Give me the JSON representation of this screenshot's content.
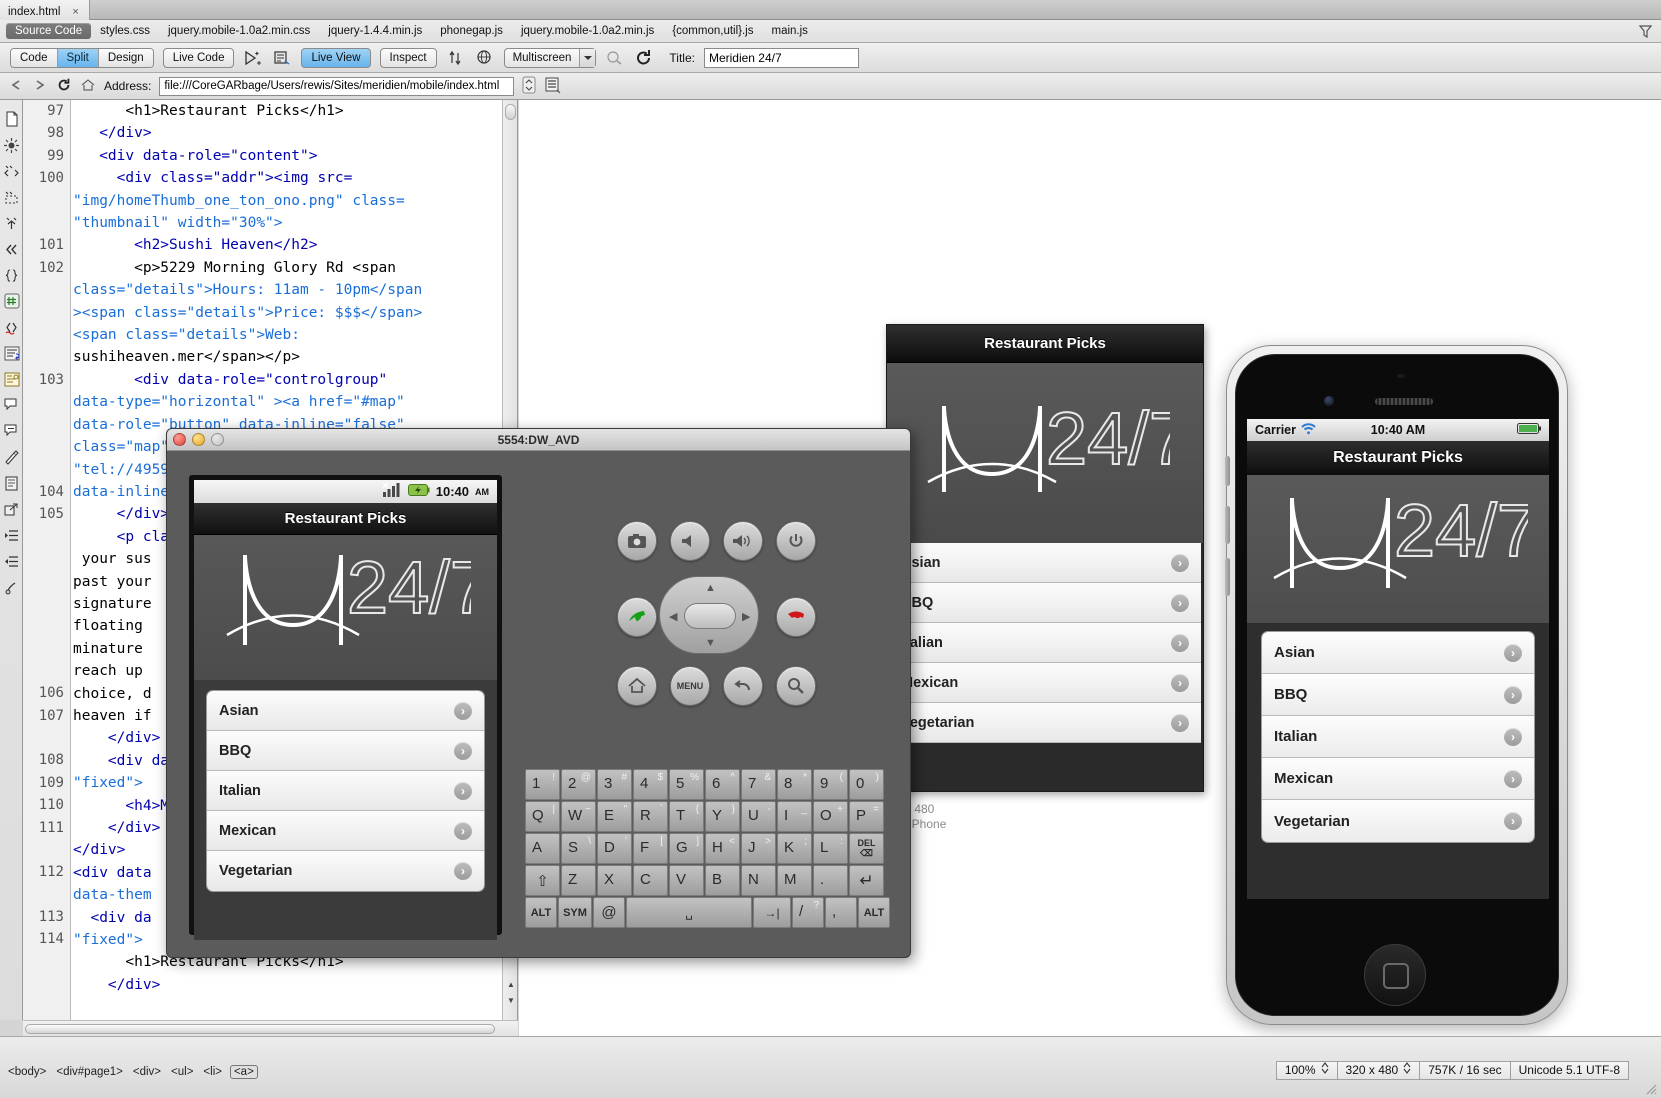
{
  "window": {
    "document_tab": "index.html",
    "close_label": "×"
  },
  "related_files": {
    "items": [
      {
        "label": "Source Code",
        "active": true
      },
      {
        "label": "styles.css",
        "active": false
      },
      {
        "label": "jquery.mobile-1.0a2.min.css",
        "active": false
      },
      {
        "label": "jquery-1.4.4.min.js",
        "active": false
      },
      {
        "label": "phonegap.js",
        "active": false
      },
      {
        "label": "jquery.mobile-1.0a2.min.js",
        "active": false
      },
      {
        "label": "{common,util}.js",
        "active": false
      },
      {
        "label": "main.js",
        "active": false
      }
    ],
    "filter_icon": "filter-icon"
  },
  "toolbar": {
    "view_modes": [
      {
        "label": "Code",
        "active": false
      },
      {
        "label": "Split",
        "active": true
      },
      {
        "label": "Design",
        "active": false
      }
    ],
    "live_code": "Live Code",
    "live_view": "Live View",
    "inspect": "Inspect",
    "multiscreen": "Multiscreen",
    "dropdown_arrow": "▼",
    "title_label": "Title:",
    "title_value": "Meridien 24/7",
    "icons": [
      "live-view-options-icon",
      "browser-check-icon",
      "validate-icon",
      "browser-preview-icon",
      "visual-aids-icon",
      "refresh-icon"
    ]
  },
  "address_bar": {
    "back_icon": "back-arrow-icon",
    "forward_icon": "forward-arrow-icon",
    "refresh_icon": "refresh-icon",
    "home_icon": "home-icon",
    "label": "Address:",
    "value": "file:///CoreGARbage/Users/rewis/Sites/meridien/mobile/index.html",
    "stepper_icon": "stepper-icon",
    "file-management_icon": "file-management-icon"
  },
  "code_rail": {
    "icons": [
      "open-documents-icon",
      "show-code-navigator-icon",
      "collapse-full-tag-icon",
      "collapse-selection-icon",
      "expand-all-icon",
      "select-parent-tag-icon",
      "balance-braces-icon",
      "line-numbers-icon",
      "highlight-invalid-code-icon",
      "word-wrap-icon",
      "syntax-color-icon",
      "apply-comment-icon",
      "remove-comment-icon",
      "wrap-tag-icon",
      "recent-snippets-icon",
      "move-to-external-icon",
      "indent-code-icon",
      "outdent-code-icon",
      "format-source-icon"
    ]
  },
  "code": {
    "lines": [
      {
        "num": "97",
        "segments": [
          {
            "t": "      ",
            "c": "tx"
          },
          {
            "t": "<h1>",
            "c": "tg"
          },
          {
            "t": "Restaurant Picks",
            "c": "tx"
          },
          {
            "t": "</h1>",
            "c": "tg"
          }
        ]
      },
      {
        "num": "98",
        "segments": [
          {
            "t": "   ",
            "c": "tx"
          },
          {
            "t": "</div>",
            "c": "tg"
          }
        ]
      },
      {
        "num": "99",
        "segments": [
          {
            "t": "   ",
            "c": "tx"
          },
          {
            "t": "<div ",
            "c": "tg"
          },
          {
            "t": "data-role=",
            "c": "at"
          },
          {
            "t": "\"content\"",
            "c": "vl"
          },
          {
            "t": ">",
            "c": "tg"
          }
        ]
      },
      {
        "num": "100",
        "segments": [
          {
            "t": "     ",
            "c": "tx"
          },
          {
            "t": "<div ",
            "c": "tg"
          },
          {
            "t": "class=",
            "c": "at"
          },
          {
            "t": "\"addr\"",
            "c": "vl"
          },
          {
            "t": ">",
            "c": "tg"
          },
          {
            "t": "<img ",
            "c": "tg"
          },
          {
            "t": "src=",
            "c": "at"
          },
          {
            "t": "\"img/homeThumb_one_ton_ono.png\" ",
            "c": "vl"
          },
          {
            "t": "class=",
            "c": "at"
          },
          {
            "t": "\"thumbnail\" ",
            "c": "vl"
          },
          {
            "t": "width=",
            "c": "at"
          },
          {
            "t": "\"30%\"",
            "c": "vl"
          },
          {
            "t": ">",
            "c": "tg"
          }
        ]
      },
      {
        "num": "101",
        "segments": [
          {
            "t": "       ",
            "c": "tx"
          },
          {
            "t": "<h2>",
            "c": "tg"
          },
          {
            "t": "Sushi Heaven",
            "c": "tx"
          },
          {
            "t": "</h2>",
            "c": "tg"
          }
        ]
      },
      {
        "num": "102",
        "segments": [
          {
            "t": "       ",
            "c": "tx"
          },
          {
            "t": "<p>",
            "c": "tg"
          },
          {
            "t": "5229 Morning Glory Rd ",
            "c": "tx"
          },
          {
            "t": "<span ",
            "c": "tg"
          },
          {
            "t": "class=",
            "c": "at"
          },
          {
            "t": "\"details\"",
            "c": "vl"
          },
          {
            "t": ">",
            "c": "tg"
          },
          {
            "t": "Hours: 11am - 10pm",
            "c": "tx"
          },
          {
            "t": "</span",
            "c": "tg"
          },
          {
            "t": "><span ",
            "c": "tg"
          },
          {
            "t": "class=",
            "c": "at"
          },
          {
            "t": "\"details\"",
            "c": "vl"
          },
          {
            "t": ">",
            "c": "tg"
          },
          {
            "t": "Price: $$$",
            "c": "tx"
          },
          {
            "t": "</span>",
            "c": "tg"
          },
          {
            "t": "<span ",
            "c": "tg"
          },
          {
            "t": "class=",
            "c": "at"
          },
          {
            "t": "\"details\"",
            "c": "vl"
          },
          {
            "t": ">",
            "c": "tg"
          },
          {
            "t": "Web: sushiheaven.mer",
            "c": "tx"
          },
          {
            "t": "</span></p>",
            "c": "tg"
          }
        ]
      },
      {
        "num": "103",
        "segments": [
          {
            "t": "       ",
            "c": "tx"
          },
          {
            "t": "<div ",
            "c": "tg"
          },
          {
            "t": "data-role=",
            "c": "at"
          },
          {
            "t": "\"controlgroup\" ",
            "c": "vl"
          },
          {
            "t": "data-type=",
            "c": "at"
          },
          {
            "t": "\"horizontal\" ",
            "c": "vl"
          },
          {
            "t": "><a ",
            "c": "gn"
          },
          {
            "t": "href=",
            "c": "at"
          },
          {
            "t": "\"#map\" ",
            "c": "vl"
          },
          {
            "t": "data-role=",
            "c": "at"
          },
          {
            "t": "\"button\" ",
            "c": "vl"
          },
          {
            "t": "data-inline=",
            "c": "at"
          },
          {
            "t": "\"false\" ",
            "c": "vl"
          },
          {
            "t": "class=",
            "c": "at"
          },
          {
            "t": "\"map\" ",
            "c": "vl"
          },
          {
            "t": "\"tel://49",
            "c": "vl"
          },
          {
            "t": "data-inli",
            "c": "at"
          }
        ]
      },
      {
        "num": "104",
        "segments": [
          {
            "t": "     ",
            "c": "tx"
          },
          {
            "t": "</div>",
            "c": "tg"
          }
        ]
      },
      {
        "num": "105",
        "segments": [
          {
            "t": "     ",
            "c": "tx"
          },
          {
            "t": "<p ",
            "c": "tg"
          },
          {
            "t": "cl",
            "c": "at"
          },
          {
            "t": "  your sus",
            "c": "tx"
          },
          {
            "t": "past your",
            "c": "tx"
          },
          {
            "t": "signature",
            "c": "tx"
          },
          {
            "t": "floating",
            "c": "tx"
          },
          {
            "t": "minature",
            "c": "tx"
          },
          {
            "t": "reach up",
            "c": "tx"
          },
          {
            "t": "choice, d",
            "c": "tx"
          },
          {
            "t": "heaven if",
            "c": "tx"
          }
        ]
      },
      {
        "num": "106",
        "segments": [
          {
            "t": "    ",
            "c": "tx"
          },
          {
            "t": "</div>",
            "c": "tg"
          }
        ]
      },
      {
        "num": "107",
        "segments": [
          {
            "t": "    ",
            "c": "tx"
          },
          {
            "t": "<div ",
            "c": "tg"
          },
          {
            "t": "da",
            "c": "at"
          },
          {
            "t": "\"fixed\"",
            "c": "vl"
          },
          {
            "t": ">",
            "c": "tg"
          }
        ]
      },
      {
        "num": "108",
        "segments": [
          {
            "t": "      ",
            "c": "tx"
          },
          {
            "t": "<h4>",
            "c": "tg"
          },
          {
            "t": "M",
            "c": "tx"
          }
        ]
      },
      {
        "num": "109",
        "segments": [
          {
            "t": "    ",
            "c": "tx"
          },
          {
            "t": "</div>",
            "c": "tg"
          }
        ]
      },
      {
        "num": "110",
        "segments": [
          {
            "t": "",
            "c": "tx"
          },
          {
            "t": "</div>",
            "c": "tg"
          }
        ]
      },
      {
        "num": "111",
        "segments": [
          {
            "t": "",
            "c": "tx"
          },
          {
            "t": "<div ",
            "c": "tg"
          },
          {
            "t": "data",
            "c": "at"
          },
          {
            "t": "data-them",
            "c": "at"
          }
        ]
      },
      {
        "num": "112",
        "segments": [
          {
            "t": "  ",
            "c": "tx"
          },
          {
            "t": "<div ",
            "c": "tg"
          },
          {
            "t": "da",
            "c": "at"
          },
          {
            "t": "\"fixed\"",
            "c": "vl"
          },
          {
            "t": ">",
            "c": "tg"
          }
        ]
      },
      {
        "num": "113",
        "segments": [
          {
            "t": "      ",
            "c": "tx"
          },
          {
            "t": "<h1>",
            "c": "tg"
          },
          {
            "t": "Restaurant Picks",
            "c": "tx"
          },
          {
            "t": "</h1>",
            "c": "tg"
          }
        ]
      },
      {
        "num": "114",
        "segments": [
          {
            "t": "    ",
            "c": "tx"
          },
          {
            "t": "</div>",
            "c": "tg"
          }
        ]
      }
    ]
  },
  "code_display": {
    "l97": "      <h1>Restaurant Picks</h1>",
    "l98": "   </div>",
    "l99": "   <div data-role=\"content\">",
    "l100a": "     <div class=\"addr\"><img src=",
    "l100b": "\"img/homeThumb_one_ton_ono.png\" class=",
    "l100c": "\"thumbnail\" width=\"30%\">",
    "l101": "       <h2>Sushi Heaven</h2>",
    "l102a": "       <p>5229 Morning Glory Rd <span",
    "l102b": "class=\"details\">Hours: 11am - 10pm</span",
    "l102c": "><span class=\"details\">Price: $$$</span>",
    "l102d": "<span class=\"details\">Web:",
    "l102e": "sushiheaven.mer</span></p>",
    "l103a": "       <div data-role=\"controlgroup\"",
    "l103b": "data-type=\"horizontal\" ><a href=\"#map\"",
    "l103c": "data-role=\"button\" data-inline=\"false\"",
    "l103d": "class=\"map\"><a href=",
    "l103e": "\"tel://4959872\" data-role=\"button\"",
    "l103f": "data-inline=\"false\">",
    "l104": "     </div>",
    "l105a": "     <p class=\"descr\">",
    "l105b": " your sus",
    "l105c": "past your",
    "l105d": "signature",
    "l105e": "floating",
    "l105f": "minature",
    "l105g": "reach up",
    "l105h": "choice, d",
    "l105i": "heaven if",
    "l106": "    </div>",
    "l107a": "    <div da",
    "l107b": "\"fixed\">",
    "l108": "      <h4>M",
    "l109": "    </div>",
    "l110": "</div>",
    "l111a": "<div data",
    "l111b": "data-them",
    "l112a": "  <div da",
    "l112b": "\"fixed\">",
    "l113": "      <h1>Restaurant Picks</h1>",
    "l114": "    </div>"
  },
  "emulator": {
    "window_title": "5554:DW_AVD",
    "status_time": "10:40",
    "status_meridiem": "AM",
    "signal_icon": "signal-bars-icon",
    "battery_icon": "battery-charging-icon",
    "app_title": "Restaurant Picks",
    "logo_text": "24/7",
    "list": [
      "Asian",
      "BBQ",
      "Italian",
      "Mexican",
      "Vegetarian"
    ],
    "chevron": "›",
    "hw_buttons": [
      {
        "name": "camera-button",
        "glyph": "📷"
      },
      {
        "name": "volume-down-button",
        "glyph": "🔉"
      },
      {
        "name": "volume-up-button",
        "glyph": "🔊"
      },
      {
        "name": "power-button",
        "glyph": "⏻"
      },
      {
        "name": "call-button",
        "glyph": "☎"
      },
      {
        "name": "end-call-button",
        "glyph": "☎"
      },
      {
        "name": "home-button",
        "glyph": "⌂"
      },
      {
        "name": "menu-button",
        "glyph": "MENU"
      },
      {
        "name": "back-button",
        "glyph": "↶"
      },
      {
        "name": "search-button",
        "glyph": "🔍"
      }
    ],
    "keyboard": {
      "row1": [
        {
          "main": "1",
          "alt": "!"
        },
        {
          "main": "2",
          "alt": "@"
        },
        {
          "main": "3",
          "alt": "#"
        },
        {
          "main": "4",
          "alt": "$"
        },
        {
          "main": "5",
          "alt": "%"
        },
        {
          "main": "6",
          "alt": "^"
        },
        {
          "main": "7",
          "alt": "&"
        },
        {
          "main": "8",
          "alt": "*"
        },
        {
          "main": "9",
          "alt": "("
        },
        {
          "main": "0",
          "alt": ")"
        }
      ],
      "row2": [
        {
          "main": "Q",
          "alt": "|"
        },
        {
          "main": "W",
          "alt": "~"
        },
        {
          "main": "E",
          "alt": "\""
        },
        {
          "main": "R",
          "alt": "`"
        },
        {
          "main": "T",
          "alt": "{"
        },
        {
          "main": "Y",
          "alt": "}"
        },
        {
          "main": "U",
          "alt": "-"
        },
        {
          "main": "I",
          "alt": "_"
        },
        {
          "main": "O",
          "alt": "+"
        },
        {
          "main": "P",
          "alt": "="
        }
      ],
      "row3": [
        {
          "main": "A",
          "alt": ""
        },
        {
          "main": "S",
          "alt": "\\"
        },
        {
          "main": "D",
          "alt": "'"
        },
        {
          "main": "F",
          "alt": "["
        },
        {
          "main": "G",
          "alt": "]"
        },
        {
          "main": "H",
          "alt": "<"
        },
        {
          "main": "J",
          "alt": ">"
        },
        {
          "main": "K",
          "alt": ";"
        },
        {
          "main": "L",
          "alt": ":"
        },
        {
          "main": "DEL",
          "alt": ""
        }
      ],
      "row4": [
        {
          "main": "⇧",
          "alt": ""
        },
        {
          "main": "Z",
          "alt": ""
        },
        {
          "main": "X",
          "alt": ""
        },
        {
          "main": "C",
          "alt": ""
        },
        {
          "main": "V",
          "alt": ""
        },
        {
          "main": "B",
          "alt": ""
        },
        {
          "main": "N",
          "alt": ""
        },
        {
          "main": "M",
          "alt": ""
        },
        {
          "main": ".",
          "alt": ""
        },
        {
          "main": "↵",
          "alt": ""
        }
      ],
      "row5": [
        {
          "main": "ALT",
          "alt": ""
        },
        {
          "main": "SYM",
          "alt": ""
        },
        {
          "main": "@",
          "alt": ""
        },
        {
          "main": "",
          "alt": ""
        },
        {
          "main": "→|",
          "alt": ""
        },
        {
          "main": "/",
          "alt": "?"
        },
        {
          "main": ",",
          "alt": ""
        },
        {
          "main": "ALT",
          "alt": ""
        }
      ]
    }
  },
  "android_preview": {
    "app_title": "Restaurant Picks",
    "logo_text": "24/7",
    "list": [
      "Asian",
      "BBQ",
      "Italian",
      "Mexican",
      "Vegetarian"
    ],
    "chevron": "›"
  },
  "multiscreen_label": {
    "line1": "x 480",
    "line2": "t Phone"
  },
  "iphone": {
    "carrier": "Carrier",
    "wifi_icon": "wifi-icon",
    "time": "10:40 AM",
    "battery_icon": "battery-icon",
    "app_title": "Restaurant Picks",
    "logo_text": "24/7",
    "list": [
      "Asian",
      "BBQ",
      "Italian",
      "Mexican",
      "Vegetarian"
    ],
    "chevron": "›"
  },
  "status_bar": {
    "tag_selector": [
      "<body>",
      "<div#page1>",
      "<div>",
      "<ul>",
      "<li>",
      "<a>"
    ],
    "selected_tag": "<a>",
    "zoom": "100%",
    "window_size": "320 x 480",
    "download": "757K / 16 sec",
    "encoding": "Unicode 5.1 UTF-8",
    "stepper": "↕"
  }
}
